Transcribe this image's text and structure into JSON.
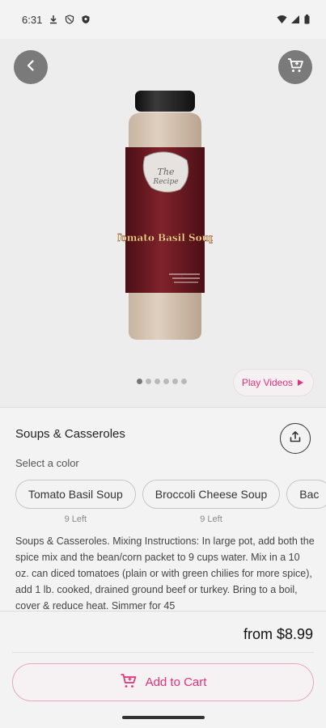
{
  "status_bar": {
    "time": "6:31",
    "icons": [
      "download-icon",
      "shield-icon",
      "shield-filled-icon",
      "wifi-icon",
      "signal-icon",
      "battery-icon"
    ]
  },
  "header": {
    "back_icon": "chevron-left-icon",
    "cart_icon": "cart-icon"
  },
  "gallery": {
    "image_label": "Tomato Basil Soup",
    "dots_total": 6,
    "dots_active_index": 0,
    "play_videos_label": "Play Videos"
  },
  "product": {
    "title": "Soups & Casseroles",
    "select_label": "Select a color",
    "variants": [
      {
        "name": "Tomato Basil Soup",
        "stock": "9 Left"
      },
      {
        "name": "Broccoli Cheese Soup",
        "stock": "9 Left"
      },
      {
        "name": "Bac",
        "stock": ""
      }
    ],
    "description": "Soups & Casseroles. Mixing Instructions: In large pot, add both the spice mix and the bean/corn packet to 9 cups water. Mix in a 10 oz. can diced tomatoes (plain or with green chilies for more spice), add 1 lb. cooked, drained ground beef or turkey. Bring to a boil, cover & reduce heat. Simmer for 45"
  },
  "footer": {
    "price": "from $8.99",
    "add_to_cart_label": "Add to Cart"
  },
  "colors": {
    "accent": "#e0337b",
    "button_gray": "#7a7a7a"
  }
}
